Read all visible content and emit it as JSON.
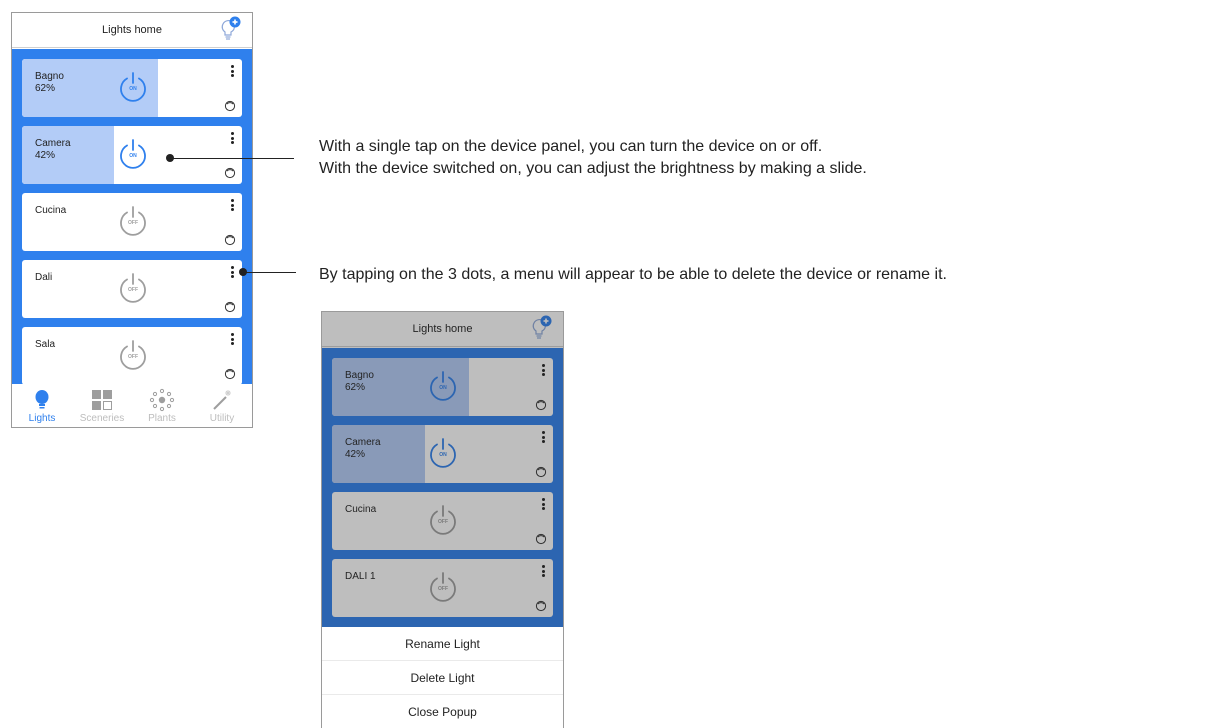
{
  "colors": {
    "accent": "#2f80ed",
    "fill_on": "#b3ccf7",
    "inactive": "#9e9e9e"
  },
  "app": {
    "title": "Lights home",
    "add_icon": "bulb-plus-icon"
  },
  "devices": [
    {
      "name": "Bagno",
      "level_text": "62%",
      "state": "ON",
      "brightness": 0.62
    },
    {
      "name": "Camera",
      "level_text": "42%",
      "state": "ON",
      "brightness": 0.42
    },
    {
      "name": "Cucina",
      "level_text": "",
      "state": "OFF",
      "brightness": 0
    },
    {
      "name": "Dali",
      "level_text": "",
      "state": "OFF",
      "brightness": 0
    },
    {
      "name": "Sala",
      "level_text": "",
      "state": "OFF",
      "brightness": 0
    }
  ],
  "devices_popup_screen": [
    {
      "name": "Bagno",
      "level_text": "62%",
      "state": "ON",
      "brightness": 0.62
    },
    {
      "name": "Camera",
      "level_text": "42%",
      "state": "ON",
      "brightness": 0.42
    },
    {
      "name": "Cucina",
      "level_text": "",
      "state": "OFF",
      "brightness": 0
    },
    {
      "name": "DALI 1",
      "level_text": "",
      "state": "OFF",
      "brightness": 0
    }
  ],
  "tabs": [
    {
      "label": "Lights",
      "icon": "bulb-icon",
      "active": true
    },
    {
      "label": "Sceneries",
      "icon": "grid-icon",
      "active": false
    },
    {
      "label": "Plants",
      "icon": "network-icon",
      "active": false
    },
    {
      "label": "Utility",
      "icon": "magic-wand-icon",
      "active": false
    }
  ],
  "popup": {
    "items": [
      "Rename Light",
      "Delete Light",
      "Close Popup"
    ]
  },
  "notes": {
    "tap_line1": "With a single tap on the device panel, you can turn the device on or off.",
    "tap_line2": "With the device switched on, you can adjust the brightness by making a slide.",
    "dots": "By tapping on the 3 dots, a menu will appear to be able to delete the device or rename it."
  }
}
